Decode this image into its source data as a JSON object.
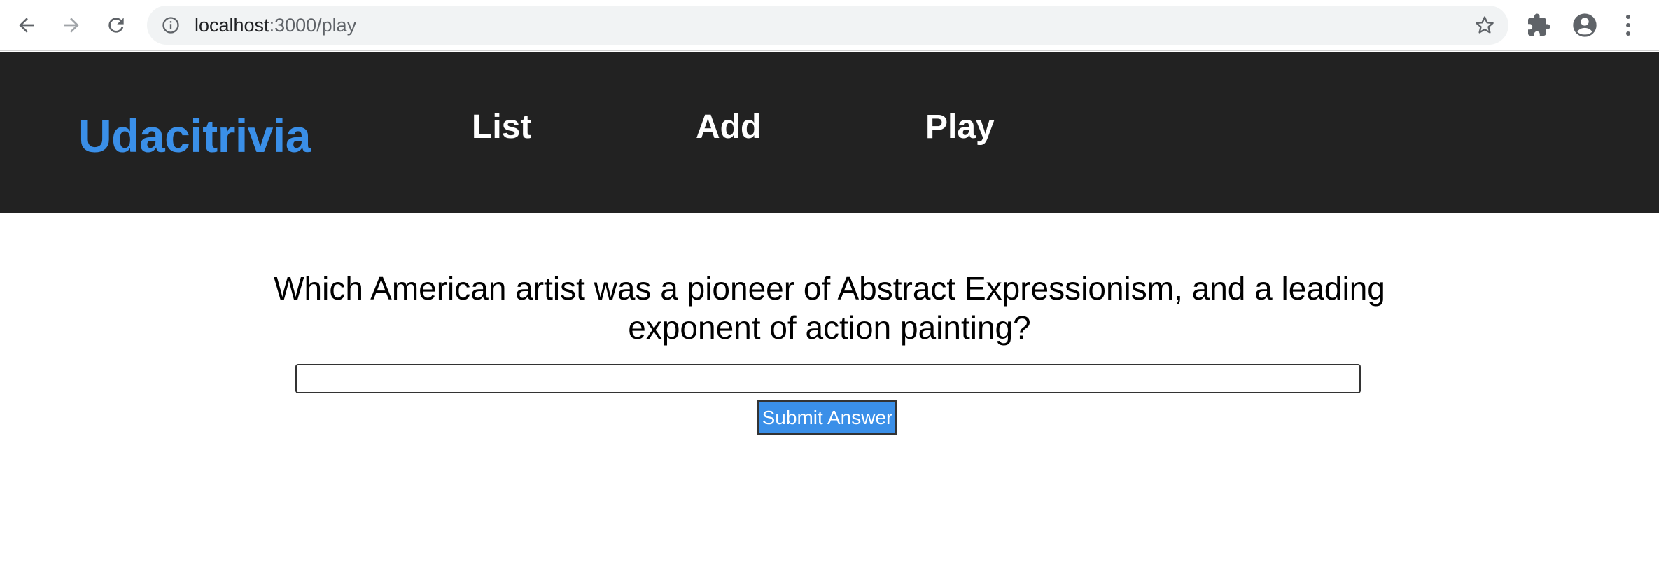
{
  "browser": {
    "url_host": "localhost",
    "url_rest": ":3000/play",
    "icons": {
      "back": "back-arrow-icon",
      "forward": "forward-arrow-icon",
      "reload": "reload-icon",
      "info": "info-icon",
      "bookmark": "star-icon",
      "extensions": "puzzle-icon",
      "profile": "account-icon",
      "menu": "kebab-menu-icon"
    }
  },
  "header": {
    "brand": "Udacitrivia",
    "nav": [
      "List",
      "Add",
      "Play"
    ]
  },
  "quiz": {
    "question": "Which American artist was a pioneer of Abstract Expressionism, and a leading exponent of action painting?",
    "answer_value": "",
    "submit_label": "Submit Answer"
  },
  "colors": {
    "brand": "#3a8fe8",
    "header_bg": "#222222",
    "button_bg": "#3a8fe8"
  }
}
